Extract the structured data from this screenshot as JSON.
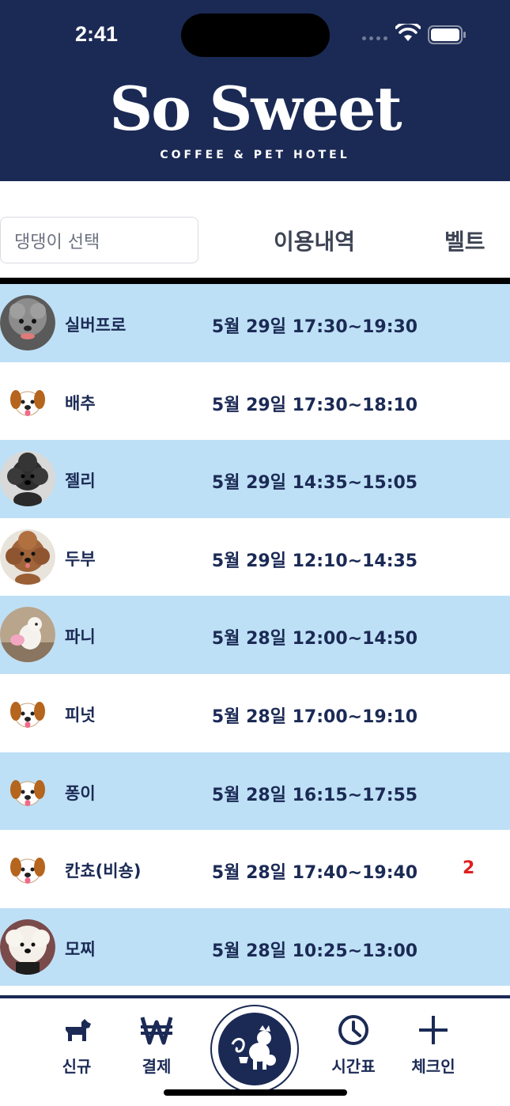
{
  "status_bar": {
    "time": "2:41"
  },
  "header": {
    "title": "So Sweet",
    "subtitle": "COFFEE & PET HOTEL"
  },
  "toolbar": {
    "dog_select_placeholder": "댕댕이 선택",
    "history_label": "이용내역",
    "bell_label": "벨트"
  },
  "records": [
    {
      "name": "실버프로",
      "time": "5월 29일 17:30~19:30",
      "avatar": "photo-grey-poodle",
      "count": ""
    },
    {
      "name": "배추",
      "time": "5월 29일 17:30~18:10",
      "avatar": "dog-emoji",
      "count": ""
    },
    {
      "name": "젤리",
      "time": "5월 29일 14:35~15:05",
      "avatar": "photo-black-poodle",
      "count": ""
    },
    {
      "name": "두부",
      "time": "5월 29일 12:10~14:35",
      "avatar": "photo-brown-poodle",
      "count": ""
    },
    {
      "name": "파니",
      "time": "5월 28일 12:00~14:50",
      "avatar": "photo-white-dog",
      "count": ""
    },
    {
      "name": "피넛",
      "time": "5월 28일 17:00~19:10",
      "avatar": "dog-emoji",
      "count": ""
    },
    {
      "name": "퐁이",
      "time": "5월 28일 16:15~17:55",
      "avatar": "dog-emoji",
      "count": ""
    },
    {
      "name": "칸쵸(비숑)",
      "time": "5월 28일 17:40~19:40",
      "avatar": "dog-emoji",
      "count": "2"
    },
    {
      "name": "모찌",
      "time": "5월 28일 10:25~13:00",
      "avatar": "photo-bichon",
      "count": ""
    }
  ],
  "bottom_nav": {
    "new_label": "신규",
    "payment_label": "결제",
    "schedule_label": "시간표",
    "checkin_label": "체크인"
  },
  "colors": {
    "navy": "#1b2a55",
    "row_alt": "#bee0f6",
    "count_red": "#e02020"
  }
}
